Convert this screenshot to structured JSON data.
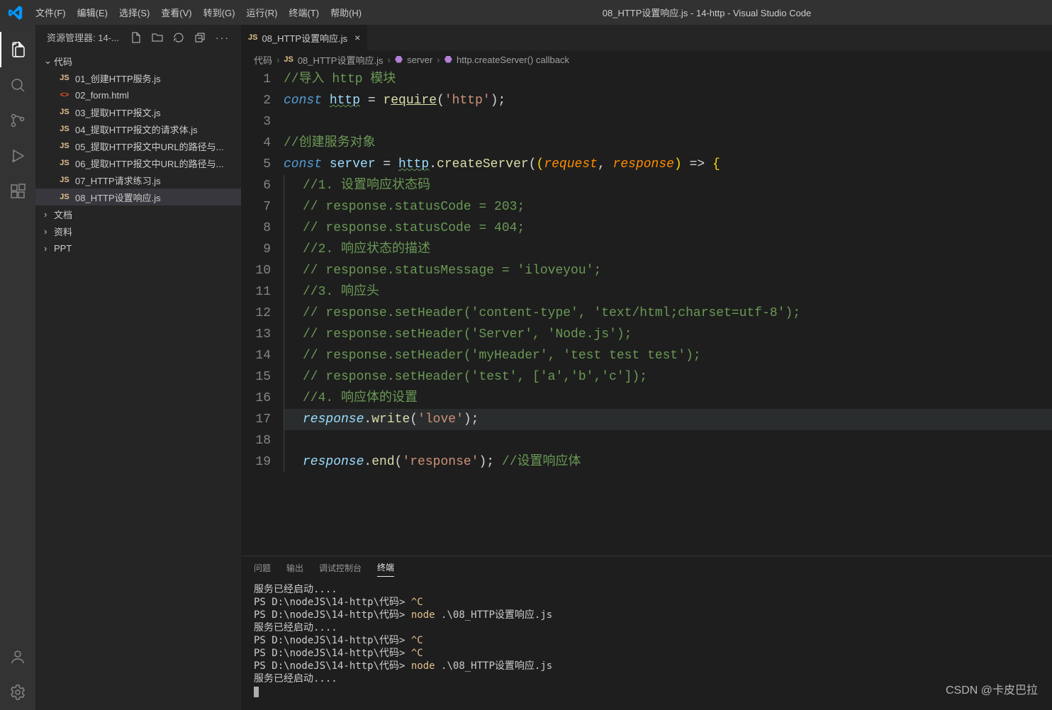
{
  "titlebar": {
    "menus": [
      "文件(F)",
      "编辑(E)",
      "选择(S)",
      "查看(V)",
      "转到(G)",
      "运行(R)",
      "终端(T)",
      "帮助(H)"
    ],
    "title": "08_HTTP设置响应.js - 14-http - Visual Studio Code"
  },
  "sidebar": {
    "header": "资源管理器: 14-...",
    "folders": [
      {
        "type": "folder",
        "open": true,
        "name": "代码"
      },
      {
        "type": "file",
        "icon": "js",
        "name": "01_创建HTTP服务.js"
      },
      {
        "type": "file",
        "icon": "html",
        "name": "02_form.html"
      },
      {
        "type": "file",
        "icon": "js",
        "name": "03_提取HTTP报文.js"
      },
      {
        "type": "file",
        "icon": "js",
        "name": "04_提取HTTP报文的请求体.js"
      },
      {
        "type": "file",
        "icon": "js",
        "name": "05_提取HTTP报文中URL的路径与..."
      },
      {
        "type": "file",
        "icon": "js",
        "name": "06_提取HTTP报文中URL的路径与..."
      },
      {
        "type": "file",
        "icon": "js",
        "name": "07_HTTP请求练习.js"
      },
      {
        "type": "file",
        "icon": "js",
        "name": "08_HTTP设置响应.js",
        "active": true
      },
      {
        "type": "folder",
        "open": false,
        "name": "文档"
      },
      {
        "type": "folder",
        "open": false,
        "name": "资料"
      },
      {
        "type": "folder",
        "open": false,
        "name": "PPT"
      }
    ]
  },
  "tab": {
    "icon": "JS",
    "label": "08_HTTP设置响应.js"
  },
  "breadcrumbs": [
    "代码",
    "08_HTTP设置响应.js",
    "server",
    "http.createServer() callback"
  ],
  "code_lines": [
    {
      "n": 1,
      "t": [
        [
          "comment",
          "//导入 http 模块"
        ]
      ]
    },
    {
      "n": 2,
      "t": [
        [
          "keyword",
          "const "
        ],
        [
          "varU",
          "http"
        ],
        [
          "punc",
          " = "
        ],
        [
          "func",
          "r"
        ],
        [
          "funcU",
          "equire"
        ],
        [
          "punc",
          "("
        ],
        [
          "string",
          "'http'"
        ],
        [
          "punc",
          ");"
        ]
      ]
    },
    {
      "n": 3,
      "t": []
    },
    {
      "n": 4,
      "t": [
        [
          "comment",
          "//创建服务对象"
        ]
      ]
    },
    {
      "n": 5,
      "t": [
        [
          "keyword",
          "const "
        ],
        [
          "var",
          "server"
        ],
        [
          "punc",
          " = "
        ],
        [
          "varU",
          "http"
        ],
        [
          "punc",
          "."
        ],
        [
          "func",
          "createServer"
        ],
        [
          "punc",
          "("
        ],
        [
          "brace",
          "("
        ],
        [
          "paramO",
          "request"
        ],
        [
          "punc",
          ", "
        ],
        [
          "paramO",
          "response"
        ],
        [
          "brace",
          ")"
        ],
        [
          "punc",
          " => "
        ],
        [
          "brace",
          "{"
        ]
      ]
    },
    {
      "n": 6,
      "indent": 1,
      "t": [
        [
          "comment",
          "//1. 设置响应状态码"
        ]
      ]
    },
    {
      "n": 7,
      "indent": 1,
      "t": [
        [
          "comment",
          "// response.statusCode = 203;"
        ]
      ]
    },
    {
      "n": 8,
      "indent": 1,
      "t": [
        [
          "comment",
          "// response.statusCode = 404;"
        ]
      ]
    },
    {
      "n": 9,
      "indent": 1,
      "t": [
        [
          "comment",
          "//2. 响应状态的描述"
        ]
      ]
    },
    {
      "n": 10,
      "indent": 1,
      "t": [
        [
          "comment",
          "// response.statusMessage = 'iloveyou';"
        ]
      ]
    },
    {
      "n": 11,
      "indent": 1,
      "t": [
        [
          "comment",
          "//3. 响应头"
        ]
      ]
    },
    {
      "n": 12,
      "indent": 1,
      "t": [
        [
          "comment",
          "// response.setHeader('content-type', 'text/html;charset=utf-8');"
        ]
      ]
    },
    {
      "n": 13,
      "indent": 1,
      "t": [
        [
          "comment",
          "// response.setHeader('Server', 'Node.js');"
        ]
      ]
    },
    {
      "n": 14,
      "indent": 1,
      "t": [
        [
          "comment",
          "// response.setHeader('myHeader', 'test test test');"
        ]
      ]
    },
    {
      "n": 15,
      "indent": 1,
      "t": [
        [
          "comment",
          "// response.setHeader('test', ['a','b','c']);"
        ]
      ]
    },
    {
      "n": 16,
      "indent": 1,
      "t": [
        [
          "comment",
          "//4. 响应体的设置"
        ]
      ]
    },
    {
      "n": 17,
      "indent": 1,
      "hl": true,
      "t": [
        [
          "param",
          "response"
        ],
        [
          "punc",
          "."
        ],
        [
          "func",
          "write"
        ],
        [
          "punc",
          "("
        ],
        [
          "string",
          "'love'"
        ],
        [
          "punc",
          ");"
        ]
      ]
    },
    {
      "n": 18,
      "indent": 1,
      "t": []
    },
    {
      "n": 19,
      "indent": 1,
      "t": [
        [
          "param",
          "response"
        ],
        [
          "punc",
          "."
        ],
        [
          "func",
          "end"
        ],
        [
          "punc",
          "("
        ],
        [
          "string",
          "'response'"
        ],
        [
          "punc",
          ");"
        ],
        [
          "punc",
          " "
        ],
        [
          "comment",
          "//设置响应体"
        ]
      ]
    }
  ],
  "panel": {
    "tabs": [
      "问题",
      "输出",
      "调试控制台",
      "终端"
    ],
    "active": 3,
    "terminal": [
      [
        [
          "txt",
          "服务已经启动...."
        ]
      ],
      [
        [
          "ps",
          "PS D:\\nodeJS\\14-http\\代码> "
        ],
        [
          "ctrl",
          "^C"
        ]
      ],
      [
        [
          "ps",
          "PS D:\\nodeJS\\14-http\\代码> "
        ],
        [
          "cmd",
          "node "
        ],
        [
          "arg",
          ".\\08_HTTP设置响应.js"
        ]
      ],
      [
        [
          "txt",
          "服务已经启动...."
        ]
      ],
      [
        [
          "ps",
          "PS D:\\nodeJS\\14-http\\代码> "
        ],
        [
          "ctrl",
          "^C"
        ]
      ],
      [
        [
          "ps",
          "PS D:\\nodeJS\\14-http\\代码> "
        ],
        [
          "ctrl",
          "^C"
        ]
      ],
      [
        [
          "ps",
          "PS D:\\nodeJS\\14-http\\代码> "
        ],
        [
          "cmd",
          "node "
        ],
        [
          "arg",
          ".\\08_HTTP设置响应.js"
        ]
      ],
      [
        [
          "txt",
          "服务已经启动...."
        ]
      ]
    ]
  },
  "watermark": "CSDN @卡皮巴拉"
}
